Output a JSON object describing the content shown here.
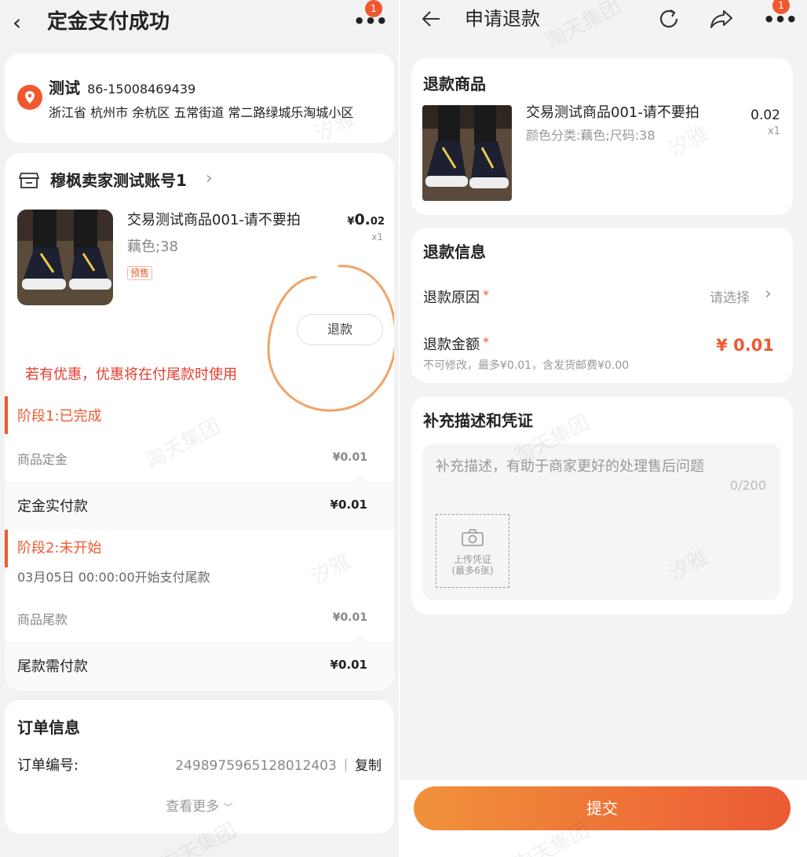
{
  "left": {
    "header": {
      "title": "定金支付成功",
      "badge_count": "1"
    },
    "address": {
      "name": "测试",
      "phone": "86-15008469439",
      "line": "浙江省 杭州市 余杭区 五常街道 常二路绿城乐淘城小区"
    },
    "shop": {
      "name": "穆枫卖家测试账号1"
    },
    "product": {
      "title": "交易测试商品001-请不要拍",
      "sku": "藕色;38",
      "tag": "预售",
      "price_symbol": "¥",
      "price_int": "0.",
      "price_dec": "02",
      "qty": "x1",
      "refund_label": "退款"
    },
    "promo_note": "若有优惠，优惠将在付尾款时使用",
    "stage1": {
      "title": "阶段1:已完成",
      "deposit_label": "商品定金",
      "deposit_value": "¥0.01",
      "paid_label": "定金实付款",
      "paid_value": "¥0.01"
    },
    "stage2": {
      "title": "阶段2:未开始",
      "start_note": "03月05日 00:00:00开始支付尾款",
      "balance_label": "商品尾款",
      "balance_value": "¥0.01",
      "due_label": "尾款需付款",
      "due_value": "¥0.01"
    },
    "order": {
      "section_title": "订单信息",
      "number_label": "订单编号:",
      "number_value": "2498975965128012403",
      "copy_label": "复制",
      "more_label": "查看更多"
    }
  },
  "right": {
    "header": {
      "title": "申请退款",
      "badge_count": "1"
    },
    "goods": {
      "section_title": "退款商品",
      "title": "交易测试商品001-请不要拍",
      "sku": "颜色分类:藕色;尺码:38",
      "price": "0.02",
      "qty": "x1"
    },
    "info": {
      "section_title": "退款信息",
      "reason_label": "退款原因",
      "reason_required": "*",
      "reason_placeholder": "请选择",
      "amount_label": "退款金额",
      "amount_required": "*",
      "amount_value": "¥ 0.01",
      "amount_note": "不可修改，最多¥0.01，含发货邮费¥0.00"
    },
    "supplement": {
      "section_title": "补充描述和凭证",
      "placeholder": "补充描述，有助于商家更好的处理售后问题",
      "counter": "0/200",
      "upload_line1": "上传凭证",
      "upload_line2": "(最多6张)"
    },
    "submit_label": "提交"
  },
  "watermarks": [
    "汐雅",
    "淘天集团"
  ],
  "colors": {
    "accent": "#f0592f",
    "button_start": "#f0923a",
    "button_end": "#ec5a35"
  }
}
